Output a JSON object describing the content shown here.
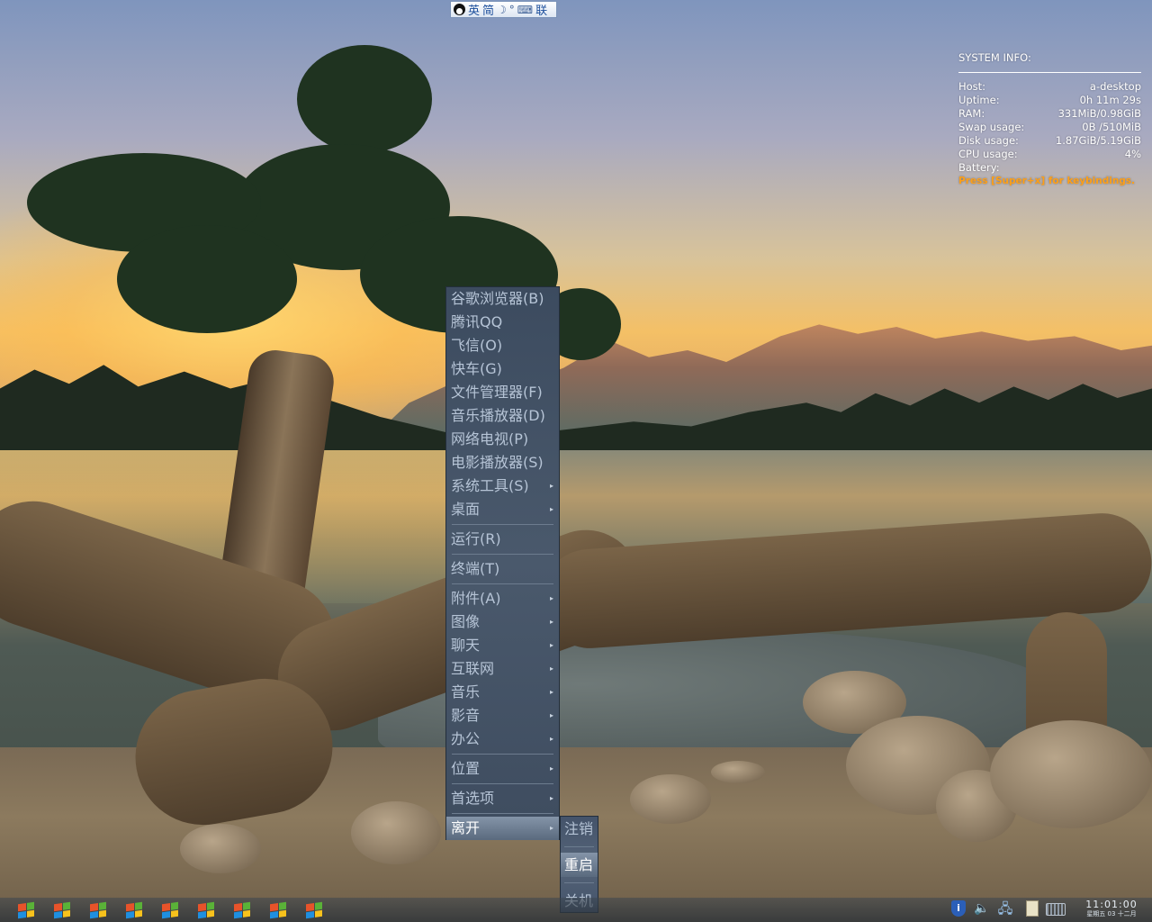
{
  "ime_bar": {
    "lang_en": "英",
    "lang_simplified": "简",
    "moon": "☽",
    "punct": "°",
    "keyboard": "⌨",
    "link": "联"
  },
  "sysinfo": {
    "title": "SYSTEM INFO:",
    "rows": [
      {
        "label": "Host:",
        "value": "a-desktop"
      },
      {
        "label": "Uptime:",
        "value": "0h 11m 29s"
      },
      {
        "label": "RAM:",
        "value": "331MiB/0.98GiB"
      },
      {
        "label": "Swap usage:",
        "value": "0B  /510MiB"
      },
      {
        "label": "Disk usage:",
        "value": "1.87GiB/5.19GiB"
      },
      {
        "label": "CPU usage:",
        "value": "4%"
      },
      {
        "label": "Battery:",
        "value": ""
      }
    ],
    "hint": "Press [Super+x] for keybindings.",
    "hint_color": "#ffa018"
  },
  "menu": {
    "items": [
      {
        "label": "谷歌浏览器(B)"
      },
      {
        "label": "腾讯QQ"
      },
      {
        "label": "飞信(O)"
      },
      {
        "label": "快车(G)"
      },
      {
        "label": "文件管理器(F)"
      },
      {
        "label": "音乐播放器(D)"
      },
      {
        "label": "网络电视(P)"
      },
      {
        "label": "电影播放器(S)"
      },
      {
        "label": "系统工具(S)"
      },
      {
        "label": "桌面"
      },
      {
        "label": "运行(R)"
      },
      {
        "label": "终端(T)"
      },
      {
        "label": "附件(A)"
      },
      {
        "label": "图像"
      },
      {
        "label": "聊天"
      },
      {
        "label": "互联网"
      },
      {
        "label": "音乐"
      },
      {
        "label": "影音"
      },
      {
        "label": "办公"
      },
      {
        "label": "位置"
      },
      {
        "label": "首选项"
      },
      {
        "label": "离开"
      }
    ],
    "arrow": "▸"
  },
  "submenu": {
    "items": [
      {
        "label": "注销"
      },
      {
        "label": "重启"
      },
      {
        "label": "关机"
      }
    ]
  },
  "taskbar": {
    "app_icons": [
      "windows-flag-icon",
      "windows-flag-icon",
      "windows-flag-icon",
      "windows-flag-icon",
      "windows-flag-icon",
      "windows-flag-icon",
      "windows-flag-icon",
      "windows-flag-icon",
      "windows-flag-icon"
    ],
    "tray": {
      "shield": "i",
      "speaker": "🔈",
      "network": "🖧"
    },
    "clock": {
      "time": "11:01:00",
      "date": "星期五 03 十二月"
    }
  },
  "colors": {
    "menu_bg": "#44536a",
    "menu_text": "#b6c4d6",
    "menu_active": "#7a8a9e",
    "ime_text": "#1d4f9c"
  }
}
